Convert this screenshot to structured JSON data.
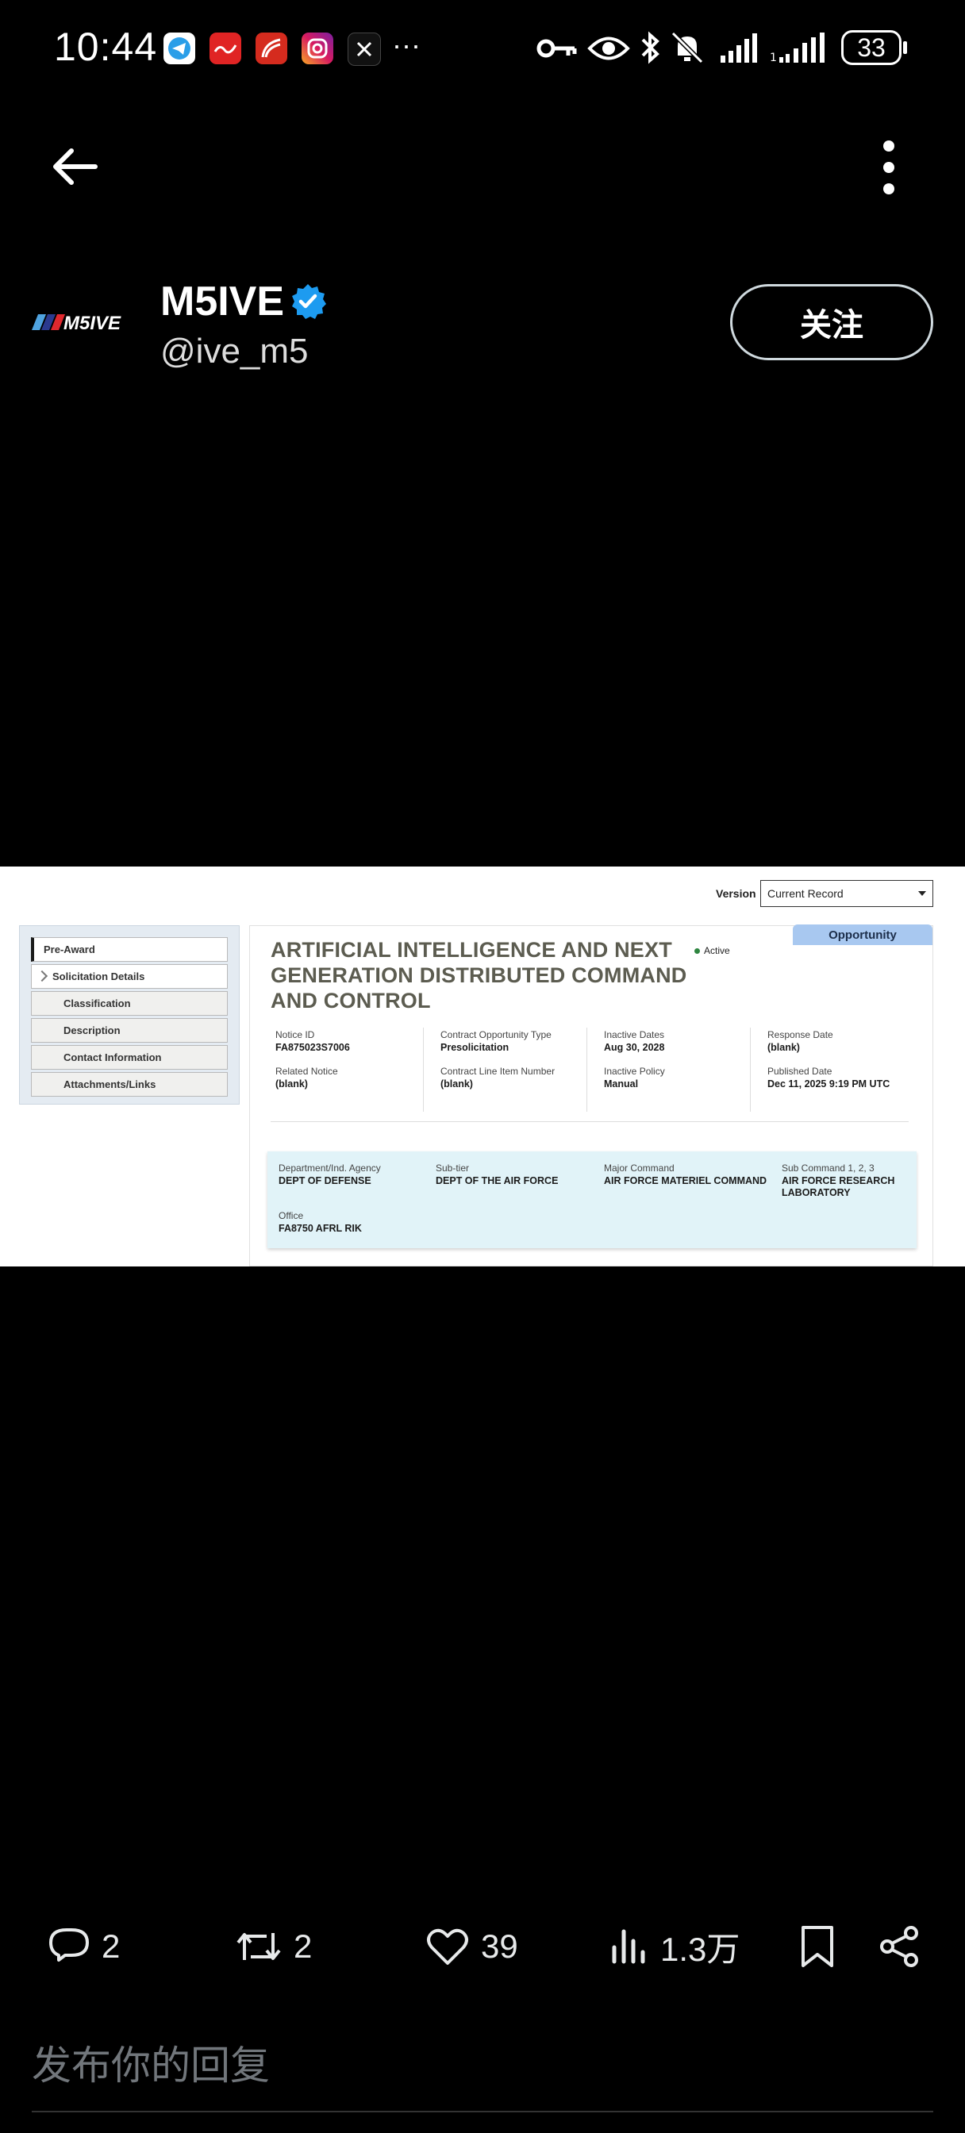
{
  "status_bar": {
    "time": "10:44",
    "overflow": "···",
    "battery": "33",
    "icons": [
      "telegram-icon",
      "news-app-icon",
      "weibo-icon",
      "instagram-icon",
      "x-icon",
      "key-icon",
      "eye-icon",
      "bluetooth-icon",
      "mute-icon",
      "signal-icon",
      "signal-icon"
    ]
  },
  "header": {
    "back_icon": "arrow-left-icon",
    "menu_icon": "more-vertical-icon"
  },
  "profile": {
    "avatar_text": "M5IVE",
    "display_name": "M5IVE",
    "handle": "@ive_m5",
    "follow_label": "关注",
    "verified_color": "#1d9bf0"
  },
  "media": {
    "version_label": "Version",
    "version_value": "Current Record",
    "sidenav": [
      "Pre-Award",
      "Solicitation Details",
      "Classification",
      "Description",
      "Contact Information",
      "Attachments/Links"
    ],
    "tab": "Opportunity",
    "title": "ARTIFICIAL INTELLIGENCE AND NEXT GENERATION DISTRIBUTED COMMAND AND CONTROL",
    "status": "Active",
    "fields": [
      {
        "label": "Notice ID",
        "value": "FA875023S7006"
      },
      {
        "label": "Contract Opportunity Type",
        "value": "Presolicitation"
      },
      {
        "label": "Inactive Dates",
        "value": "Aug 30, 2028"
      },
      {
        "label": "Response Date",
        "value": "(blank)"
      },
      {
        "label": "Related Notice",
        "value": "(blank)"
      },
      {
        "label": "Contract Line Item Number",
        "value": "(blank)"
      },
      {
        "label": "Inactive Policy",
        "value": "Manual"
      },
      {
        "label": "Published Date",
        "value": "Dec 11, 2025 9:19 PM UTC"
      }
    ],
    "org": [
      {
        "label": "Department/Ind. Agency",
        "value": "DEPT OF DEFENSE"
      },
      {
        "label": "Sub-tier",
        "value": "DEPT OF THE AIR FORCE"
      },
      {
        "label": "Major Command",
        "value": "AIR FORCE MATERIEL COMMAND"
      },
      {
        "label": "Sub Command 1, 2, 3",
        "value": "AIR FORCE RESEARCH LABORATORY"
      },
      {
        "label": "Office",
        "value": "FA8750 AFRL RIK"
      }
    ]
  },
  "actions": {
    "replies": "2",
    "reposts": "2",
    "likes": "39",
    "views": "1.3万"
  },
  "reply": {
    "placeholder": "发布你的回复"
  }
}
